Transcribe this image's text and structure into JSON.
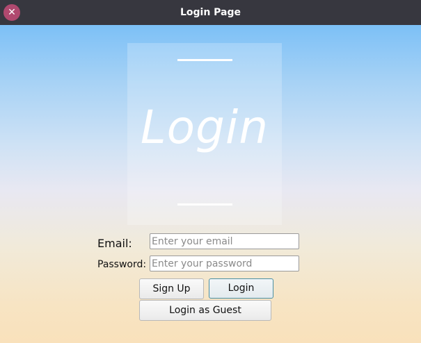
{
  "window": {
    "title": "Login Page",
    "close_glyph": "✕"
  },
  "logo": {
    "text": "Login"
  },
  "form": {
    "email_label": "Email:",
    "email_placeholder": "Enter your email",
    "email_value": "",
    "password_label": "Password:",
    "password_placeholder": "Enter your password",
    "password_value": ""
  },
  "buttons": {
    "signup": "Sign Up",
    "login": "Login",
    "guest": "Login as Guest"
  },
  "colors": {
    "titlebar": "#37373f",
    "close_button": "#b0496f",
    "login_button_border": "#4a8fa3"
  }
}
